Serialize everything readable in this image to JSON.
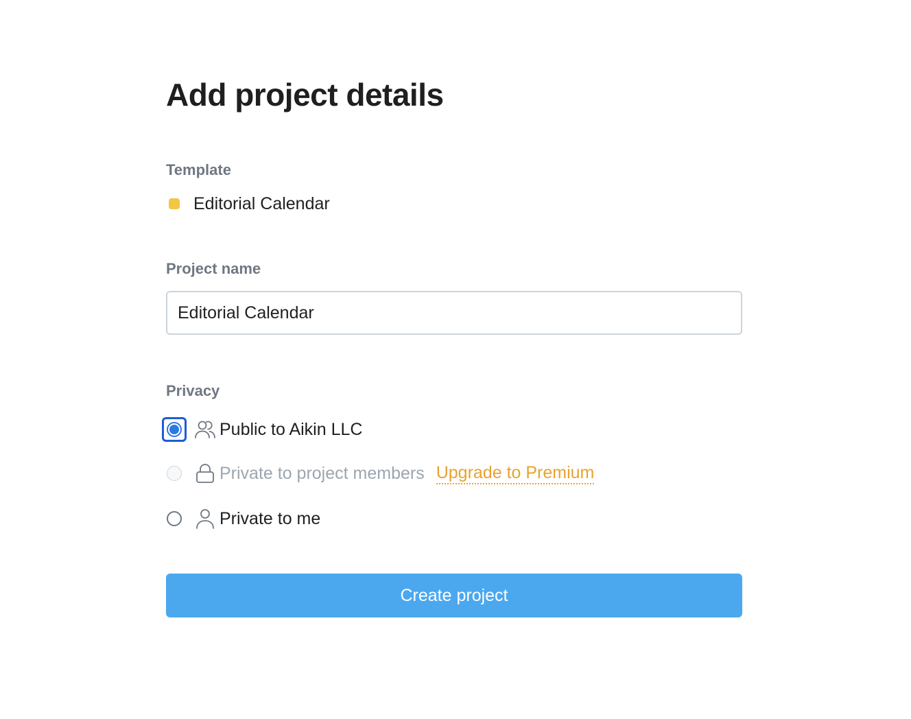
{
  "page": {
    "title": "Add project details"
  },
  "template": {
    "label": "Template",
    "name": "Editorial Calendar",
    "color": "#f1c744"
  },
  "project_name": {
    "label": "Project name",
    "value": "Editorial Calendar"
  },
  "privacy": {
    "label": "Privacy",
    "options": [
      {
        "label": "Public to Aikin LLC",
        "icon": "people-icon",
        "selected": true,
        "disabled": false
      },
      {
        "label": "Private to project members",
        "icon": "lock-icon",
        "selected": false,
        "disabled": true
      },
      {
        "label": "Private to me",
        "icon": "person-icon",
        "selected": false,
        "disabled": false
      }
    ],
    "upgrade_link": "Upgrade to Premium"
  },
  "create_button": {
    "label": "Create project"
  },
  "colors": {
    "accent_blue": "#4ba8ef",
    "upgrade_orange": "#e8a230",
    "focus_blue": "#1f5bd6"
  }
}
